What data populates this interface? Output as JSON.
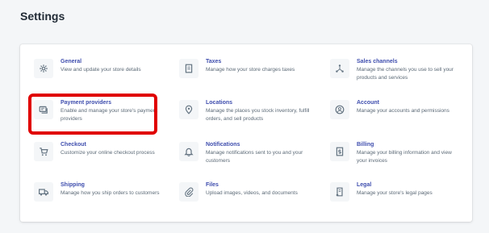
{
  "page": {
    "title": "Settings"
  },
  "settings": {
    "general": {
      "title": "General",
      "desc": "View and update your store details",
      "icon": "gear-icon"
    },
    "taxes": {
      "title": "Taxes",
      "desc": "Manage how your store charges taxes",
      "icon": "receipt-icon"
    },
    "sales_channels": {
      "title": "Sales channels",
      "desc": "Manage the channels you use to sell your products and services",
      "icon": "channels-icon"
    },
    "payment_providers": {
      "title": "Payment providers",
      "desc": "Enable and manage your store's payment providers",
      "icon": "payment-icon"
    },
    "locations": {
      "title": "Locations",
      "desc": "Manage the places you stock inventory, fulfill orders, and sell products",
      "icon": "location-pin-icon"
    },
    "account": {
      "title": "Account",
      "desc": "Manage your accounts and permissions",
      "icon": "user-icon"
    },
    "checkout": {
      "title": "Checkout",
      "desc": "Customize your online checkout process",
      "icon": "cart-icon"
    },
    "notifications": {
      "title": "Notifications",
      "desc": "Manage notifications sent to you and your customers",
      "icon": "bell-icon"
    },
    "billing": {
      "title": "Billing",
      "desc": "Manage your billing information and view your invoices",
      "icon": "invoice-icon"
    },
    "shipping": {
      "title": "Shipping",
      "desc": "Manage how you ship orders to customers",
      "icon": "truck-icon"
    },
    "files": {
      "title": "Files",
      "desc": "Upload images, videos, and documents",
      "icon": "paperclip-icon"
    },
    "legal": {
      "title": "Legal",
      "desc": "Manage your store's legal pages",
      "icon": "legal-document-icon"
    }
  },
  "colors": {
    "accent": "#3f4eae",
    "highlight": "#e00000",
    "background": "#f4f6f8"
  }
}
